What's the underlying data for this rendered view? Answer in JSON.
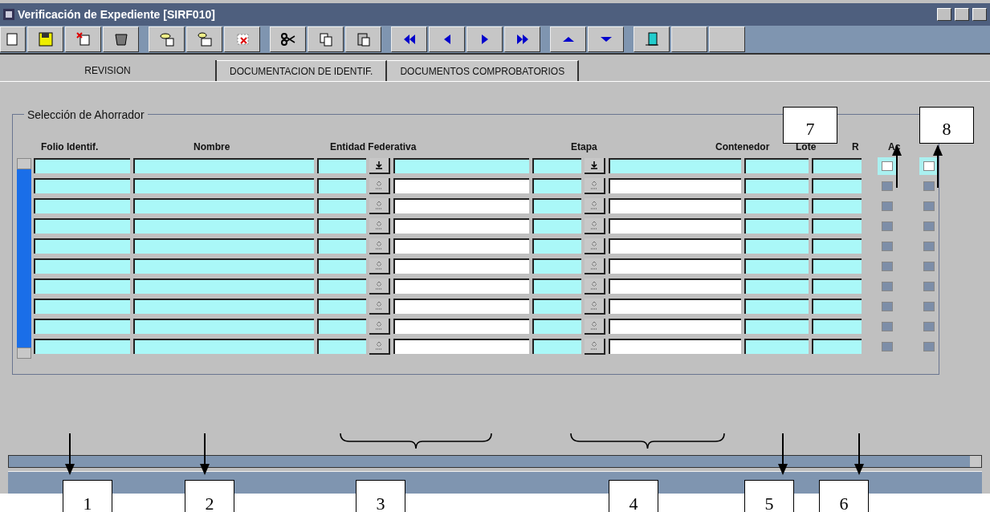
{
  "window": {
    "title": "Verificación de Expediente [SIRF010]"
  },
  "tabs": [
    {
      "label": "REVISION",
      "selected": true
    },
    {
      "label": "DOCUMENTACION DE IDENTIF.",
      "selected": false
    },
    {
      "label": "DOCUMENTOS COMPROBATORIOS",
      "selected": false
    }
  ],
  "group": {
    "title": "Selección de Ahorrador"
  },
  "columns": [
    "Folio Identif.",
    "Nombre",
    "Entidad Federativa",
    "Etapa",
    "Contenedor",
    "Lote",
    "R",
    "Ac"
  ],
  "rows": [
    {
      "selected": true
    },
    {
      "selected": false
    },
    {
      "selected": false
    },
    {
      "selected": false
    },
    {
      "selected": false
    },
    {
      "selected": false
    },
    {
      "selected": false
    },
    {
      "selected": false
    },
    {
      "selected": false
    },
    {
      "selected": false
    }
  ],
  "callouts": [
    {
      "label": "1",
      "kind": "arrow"
    },
    {
      "label": "2",
      "kind": "arrow"
    },
    {
      "label": "3",
      "kind": "brace"
    },
    {
      "label": "4",
      "kind": "brace"
    },
    {
      "label": "5",
      "kind": "arrow"
    },
    {
      "label": "6",
      "kind": "arrow"
    },
    {
      "label": "7",
      "kind": "up"
    },
    {
      "label": "8",
      "kind": "up"
    }
  ]
}
